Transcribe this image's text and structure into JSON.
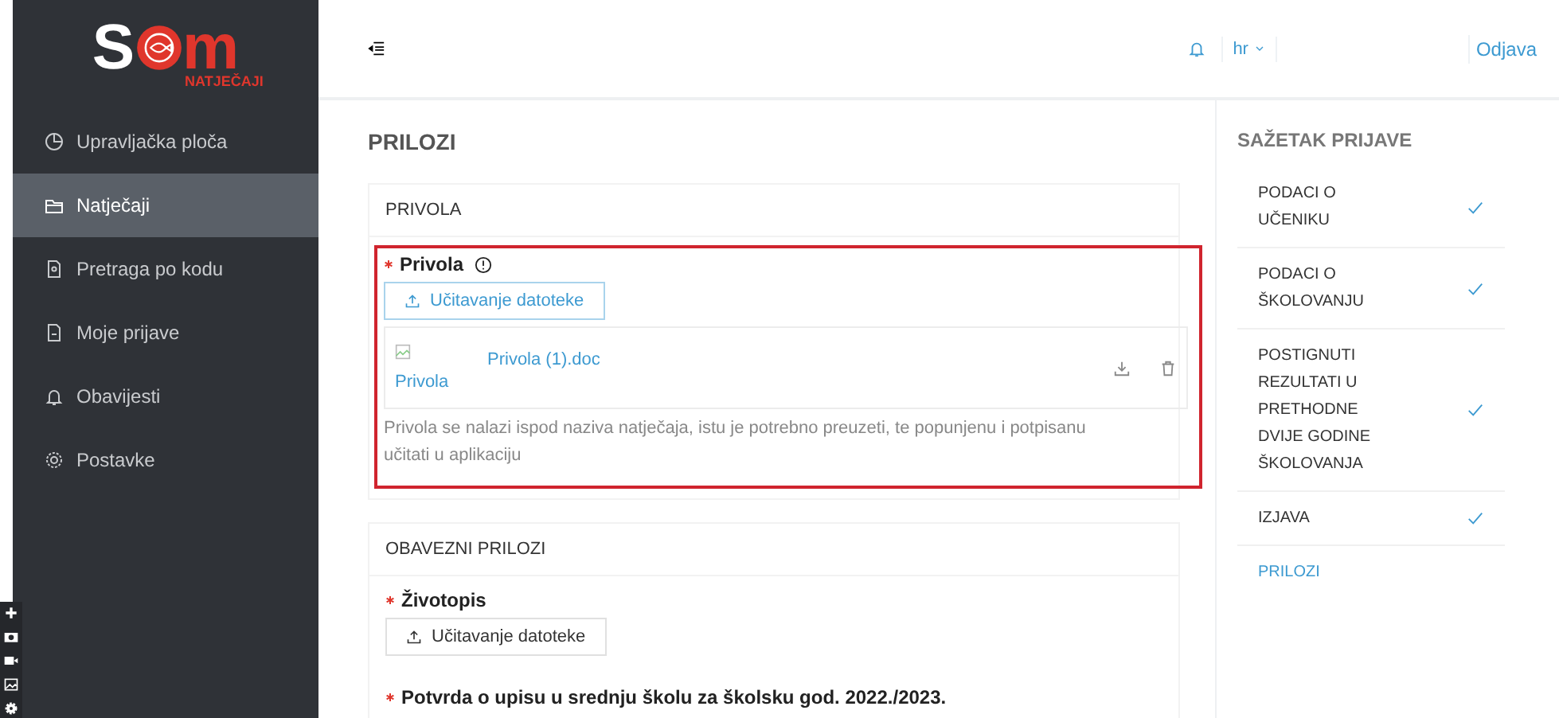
{
  "logo": {
    "left": "S",
    "right": "m",
    "subtitle": "NATJEČAJI"
  },
  "sidebar": {
    "items": [
      {
        "label": "Upravljačka ploča",
        "kind": "pie",
        "selected": false
      },
      {
        "label": "Natječaji",
        "kind": "folder",
        "selected": true
      },
      {
        "label": "Pretraga po kodu",
        "kind": "docsearch",
        "selected": false
      },
      {
        "label": "Moje prijave",
        "kind": "doc",
        "selected": false
      },
      {
        "label": "Obavijesti",
        "kind": "bell",
        "selected": false
      },
      {
        "label": "Postavke",
        "kind": "gear",
        "selected": false
      }
    ]
  },
  "header": {
    "language": "hr",
    "logout": "Odjava"
  },
  "page": {
    "title": "PRILOZI"
  },
  "sections": [
    {
      "title": "PRIVOLA",
      "fields": [
        {
          "label": "Privola",
          "required": true,
          "info": true,
          "highlighted": true,
          "upload_button": {
            "label": "Učitavanje datoteke",
            "primary": true
          },
          "files": [
            {
              "alt": "Privola",
              "name": "Privola (1).doc"
            }
          ],
          "hint": "Privola se nalazi ispod naziva natječaja, istu je potrebno preuzeti, te popunjenu i potpisanu učitati u aplikaciju"
        }
      ]
    },
    {
      "title": "OBAVEZNI PRILOZI",
      "fields": [
        {
          "label": "Životopis",
          "required": true,
          "info": false,
          "highlighted": false,
          "upload_button": {
            "label": "Učitavanje datoteke",
            "primary": false
          }
        },
        {
          "label": "Potvrda o upisu u srednju školu za školsku god. 2022./2023.",
          "required": true,
          "info": false,
          "highlighted": false
        }
      ]
    }
  ],
  "summary": {
    "title": "SAŽETAK PRIJAVE",
    "items": [
      {
        "label": "PODACI O UČENIKU",
        "done": true,
        "selected": false
      },
      {
        "label": "PODACI O ŠKOLOVANJU",
        "done": true,
        "selected": false
      },
      {
        "label": "POSTIGNUTI REZULTATI U PRETHODNE DVIJE GODINE ŠKOLOVANJA",
        "done": true,
        "selected": false
      },
      {
        "label": "IZJAVA",
        "done": true,
        "selected": false
      },
      {
        "label": "PRILOZI",
        "done": false,
        "selected": true
      }
    ]
  }
}
